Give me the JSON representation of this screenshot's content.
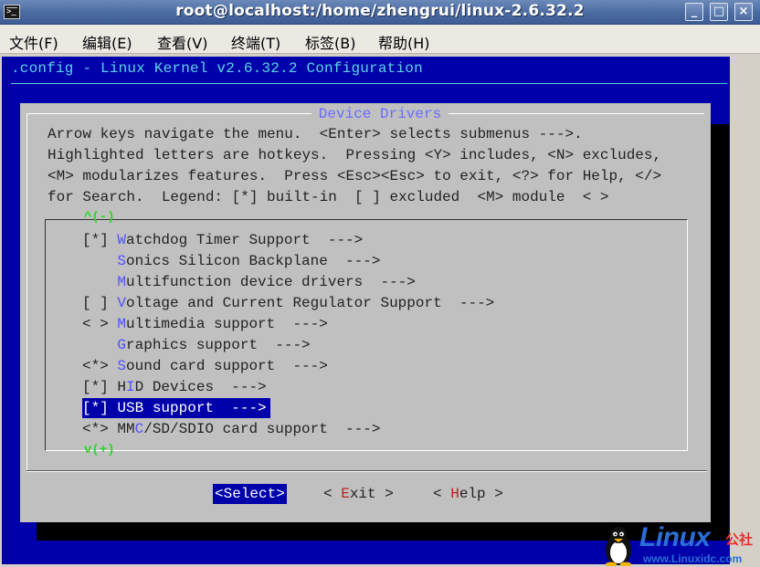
{
  "window": {
    "title": "root@localhost:/home/zhengrui/linux-2.6.32.2",
    "buttons": {
      "minimize": "_",
      "maximize": "□",
      "close": "×"
    }
  },
  "menubar": [
    {
      "label": "文件(F)"
    },
    {
      "label": "编辑(E)"
    },
    {
      "label": "查看(V)"
    },
    {
      "label": "终端(T)"
    },
    {
      "label": "标签(B)"
    },
    {
      "label": "帮助(H)"
    }
  ],
  "config_header": ".config - Linux Kernel v2.6.32.2 Configuration",
  "dialog": {
    "title": "Device Drivers",
    "help_lines": [
      "Arrow keys navigate the menu.  <Enter> selects submenus --->.",
      "Highlighted letters are hotkeys.  Pressing <Y> includes, <N> excludes,",
      "<M> modularizes features.  Press <Esc><Esc> to exit, <?> for Help, </>",
      "for Search.  Legend: [*] built-in  [ ] excluded  <M> module  < >"
    ],
    "scroll_up": "^(-)",
    "scroll_down": "v(+)",
    "items": [
      {
        "prefix": "[*] ",
        "hot": "W",
        "rest": "atchdog Timer Support  --->"
      },
      {
        "prefix": "    ",
        "hot": "S",
        "rest": "onics Silicon Backplane  --->"
      },
      {
        "prefix": "    ",
        "hot": "M",
        "rest": "ultifunction device drivers  --->"
      },
      {
        "prefix": "[ ] ",
        "hot": "V",
        "rest": "oltage and Current Regulator Support  --->"
      },
      {
        "prefix": "< > ",
        "hot": "M",
        "rest": "ultimedia support  --->"
      },
      {
        "prefix": "    ",
        "hot": "G",
        "rest": "raphics support  --->"
      },
      {
        "prefix": "<*> ",
        "hot": "S",
        "rest": "ound card support  --->"
      },
      {
        "prefix": "[*] ",
        "pre_hot": "H",
        "hot": "I",
        "rest": "D Devices  --->"
      },
      {
        "prefix": "[*] ",
        "hot": "U",
        "rest": "SB support  --->",
        "selected": true
      },
      {
        "prefix": "<*> ",
        "pre_hot": "MM",
        "hot": "C",
        "rest": "/SD/SDIO card support  --->"
      }
    ],
    "buttons": {
      "select": {
        "open": "<",
        "hot": "S",
        "rest": "elect",
        "close": ">"
      },
      "exit": {
        "open": "< ",
        "hot": "E",
        "rest": "xit",
        "close": " >"
      },
      "help": {
        "open": "< ",
        "hot": "H",
        "rest": "elp",
        "close": " >"
      }
    }
  },
  "watermark": {
    "brand": "Linux",
    "brand_cn": "公社",
    "url": "www.Linuxidc.com"
  },
  "colors": {
    "terminal_bg": "#0000aa",
    "dialog_bg": "#c0c0c0",
    "hotkey": "#5050ff",
    "scroll_mark": "#22dd22",
    "header_text": "#5bd4e6"
  }
}
